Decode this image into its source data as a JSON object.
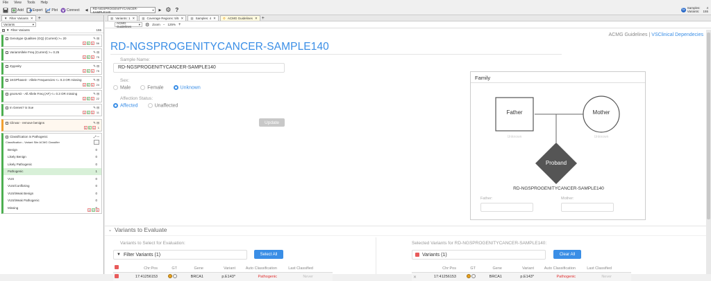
{
  "menu": [
    "File",
    "View",
    "Tools",
    "Help"
  ],
  "toolbar": {
    "add": "Add",
    "export": "Export",
    "plot": "Plot",
    "connect": "Connect",
    "project": "RD-NGSPROGENITYCANCER-SAMPLE140",
    "samples_label": "Samples:",
    "samples_value": "4",
    "variants_label": "Variants:",
    "variants_value": "155"
  },
  "left": {
    "tab": "Filter Variants",
    "dropdown": "Variants",
    "header": "Filter Variants",
    "header_count": "155",
    "cards": [
      {
        "label": "Genotype Qualities (GQ) (Current) >= 20",
        "count": "56",
        "badges": [
          "1",
          "0",
          "1"
        ],
        "orange": false
      },
      {
        "label": "VariantAllele Freq (Current) >= 0.25",
        "count": "75",
        "badges": [
          "1",
          "0",
          "1"
        ],
        "orange": false
      },
      {
        "label": "Zygosity",
        "count": "75",
        "badges": [
          "1",
          "0",
          "1"
        ],
        "orange": false
      },
      {
        "label": "1KGPhase3 - Allele Frequencies <= 0.3 OR missing",
        "count": "24",
        "badges": [
          "1",
          "0",
          "1"
        ],
        "orange": false
      },
      {
        "label": "gnomAD - All Allele Freq (AF) <= 0.3 OR missing",
        "count": "22",
        "badges": [
          "1",
          "0",
          "1"
        ],
        "orange": false
      },
      {
        "label": "In Genes? is true",
        "count": "11",
        "badges": [
          "1",
          "0",
          "1"
        ],
        "orange": false
      },
      {
        "label": "Clinvar - remove benigns",
        "count": "1",
        "badges": [
          "1",
          "0",
          "1"
        ],
        "orange": true
      }
    ],
    "classification": {
      "title": "Classification is Pathogenic",
      "subtitle": "Classification - Variant Site ACMG Classifier",
      "rows": [
        {
          "label": "Benign",
          "count": "0"
        },
        {
          "label": "Likely Benign",
          "count": "0"
        },
        {
          "label": "Likely Pathogenic",
          "count": "0"
        },
        {
          "label": "Pathogenic",
          "count": "1"
        },
        {
          "label": "VUS",
          "count": "0"
        },
        {
          "label": "VUS/Conflicting",
          "count": "0"
        },
        {
          "label": "VUS/Weak Benign",
          "count": "0"
        },
        {
          "label": "VUS/Weak Pathogenic",
          "count": "0"
        },
        {
          "label": "Missing",
          "count": "0"
        }
      ],
      "badges": [
        "1",
        "0",
        "1"
      ]
    }
  },
  "doctabs": [
    {
      "label": "Variants: 1",
      "active": false
    },
    {
      "label": "Coverage Regions: 5/5",
      "active": false
    },
    {
      "label": "Samples: 4",
      "active": false
    },
    {
      "label": "ACMG Guidelines",
      "active": true
    }
  ],
  "subbar": {
    "view": "ACMG Guidelines",
    "zoom_label": "Zoom",
    "zoom_value": "125%"
  },
  "links": {
    "acmg": "ACMG Guidelines",
    "sep": "|",
    "deps": "VSClinical Dependecies"
  },
  "page_title": "RD-NGSPROGENITYCANCER-SAMPLE140",
  "form": {
    "sample_name_label": "Sample Name:",
    "sample_name_value": "RD-NGSPROGENITYCANCER-SAMPLE140",
    "sex_label": "Sex:",
    "sex_options": [
      "Male",
      "Female",
      "Unknown"
    ],
    "sex_selected": "Unknown",
    "affection_label": "Affection Status:",
    "affection_options": [
      "Affected",
      "Unaffected"
    ],
    "affection_selected": "Affected",
    "update_button": "Update"
  },
  "family": {
    "title": "Family",
    "father": "Father",
    "mother": "Mother",
    "father_status": "Unknown",
    "mother_status": "Unknown",
    "proband": "Proband",
    "proband_name": "RD-NGSPROGENITYCANCER-SAMPLE140",
    "father_field": "Father:",
    "mother_field": "Mother:"
  },
  "evaluate": {
    "section_title": "Variants to Evaluate",
    "left_caption": "Variants to Select for Evaluation:",
    "left_source": "Filter Variants (1)",
    "select_all": "Select All",
    "right_caption": "Selected Variants for RD-NGSPROGENITYCANCER-SAMPLE140:",
    "right_source": "Variants (1)",
    "clear_all": "Clear All",
    "columns": [
      "Chr:Pos",
      "GT",
      "Gene",
      "Variant",
      "Auto Classification",
      "Last Classified"
    ],
    "left_rows": [
      {
        "chrpos": "17:41256153",
        "gene": "BRCA1",
        "variant": "p.E143*",
        "auto": "Pathogenic",
        "last": "Never"
      }
    ],
    "right_rows": [
      {
        "chrpos": "17:41256153",
        "gene": "BRCA1",
        "variant": "p.E143*",
        "auto": "Pathogenic",
        "last": "Never"
      }
    ]
  },
  "colors": {
    "accent": "#3a8ee6",
    "pathogenic": "#e03030",
    "gt_dot": "#e8a020",
    "sel_red": "#e85a5a"
  }
}
